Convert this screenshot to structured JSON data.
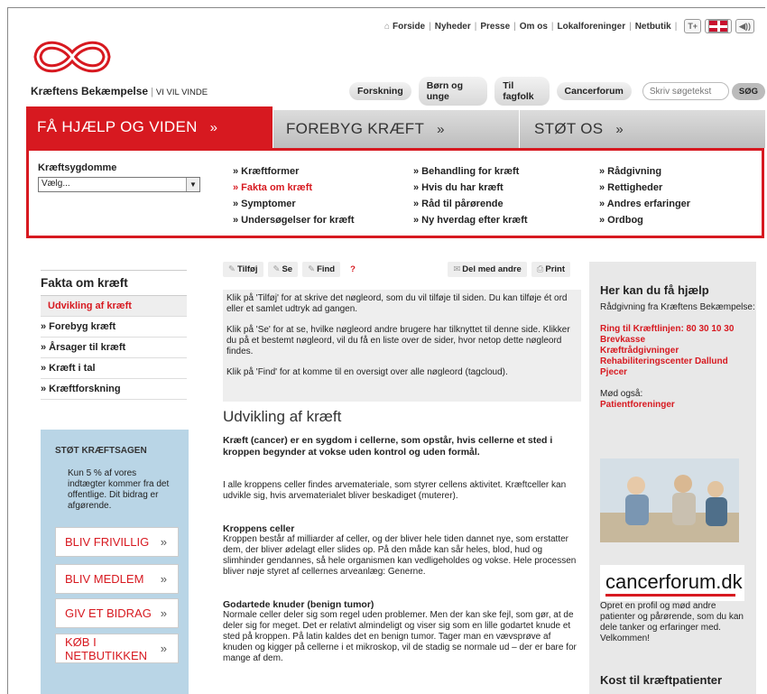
{
  "topnav": {
    "links": [
      "Forside",
      "Nyheder",
      "Presse",
      "Om os",
      "Lokalforeninger",
      "Netbutik"
    ],
    "text_size_button": "T+",
    "sound_button": "◀))"
  },
  "logo": {
    "name": "Kræftens Bekæmpelse",
    "slogan": "VI VIL VINDE"
  },
  "mainnav": [
    "Forskning",
    "Børn og unge",
    "Til fagfolk",
    "Cancerforum"
  ],
  "search": {
    "placeholder": "Skriv søgetekst",
    "button": "SØG"
  },
  "tabs": [
    {
      "label": "FÅ HJÆLP OG VIDEN",
      "arrow": "»"
    },
    {
      "label": "FOREBYG KRÆFT",
      "arrow": "»"
    },
    {
      "label": "STØT OS",
      "arrow": "»"
    }
  ],
  "mega": {
    "dropdown_label": "Kræftsygdomme",
    "dropdown_value": "Vælg...",
    "col1": [
      "» Kræftformer",
      "» Fakta om kræft",
      "» Symptomer",
      "» Undersøgelser for kræft"
    ],
    "col2": [
      "» Behandling for kræft",
      "» Hvis du har kræft",
      "» Råd til pårørende",
      "» Ny hverdag efter kræft"
    ],
    "col3": [
      "» Rådgivning",
      "» Rettigheder",
      "» Andres erfaringer",
      "» Ordbog"
    ]
  },
  "leftnav": {
    "heading": "Fakta om kræft",
    "active": "Udvikling af kræft",
    "items": [
      "» Forebyg kræft",
      "» Årsager til kræft",
      "» Kræft i tal",
      "» Kræftforskning"
    ]
  },
  "support": {
    "heading": "STØT KRÆFTSAGEN",
    "text": "Kun 5 % af vores indtægter kommer fra det offentlige. Dit bidrag er afgørende.",
    "buttons": [
      "BLIV FRIVILLIG",
      "BLIV MEDLEM",
      "GIV ET BIDRAG",
      "KØB I NETBUTIKKEN"
    ],
    "arrow": "»"
  },
  "tagbar": {
    "add": "Tilføj",
    "see": "Se",
    "find": "Find",
    "help": "?",
    "share": "Del med andre",
    "print": "Print"
  },
  "tagbox": {
    "p1": "Klik på 'Tilføj' for at skrive det nøgleord, som du vil tilføje til siden. Du kan tilføje ét ord eller et samlet udtryk ad gangen.",
    "p2": "Klik på 'Se' for at se, hvilke nøgleord andre brugere har tilknyttet til denne side. Klikker du på et bestemt nøgleord, vil du få en liste over de sider, hvor netop dette nøgleord findes.",
    "p3": "Klik på 'Find' for at komme til en oversigt over alle nøgleord (tagcloud)."
  },
  "article": {
    "title": "Udvikling af kræft",
    "lead": "Kræft (cancer) er en sygdom i cellerne, som opstår, hvis cellerne et sted i kroppen begynder at vokse uden kontrol og uden formål.",
    "p1": "I alle kroppens celler findes arvemateriale, som styrer cellens aktivitet. Kræftceller kan udvikle sig, hvis arvematerialet bliver beskadiget (muterer).",
    "h2": "Kroppens celler",
    "p2": "Kroppen består af milliarder af celler, og der bliver hele tiden dannet nye, som erstatter dem, der bliver ødelagt eller slides op. På den måde kan sår heles, blod, hud og slimhinder gendannes, så hele organismen kan vedligeholdes og vokse. Hele processen bliver nøje styret af cellernes arveanlæg: Generne.",
    "h3": "Godartede knuder (benign tumor)",
    "p3": "Normale celler deler sig som regel uden problemer. Men der kan ske fejl, som gør, at de deler sig for meget. Det er relativt almindeligt og viser sig som en lille godartet knude et sted på kroppen. På latin kaldes det en benign tumor. Tager man en vævsprøve af knuden og kigger på cellerne i et mikroskop, vil de stadig se normale ud – der er bare for mange af dem."
  },
  "rightside": {
    "heading": "Her kan du få hjælp",
    "intro": "Rådgivning fra Kræftens Bekæmpelse:",
    "links": [
      "Ring til Kræftlinjen: 80 30 10 30",
      "Brevkasse",
      "Kræftrådgivninger",
      "Rehabiliteringscenter Dallund",
      "Pjecer"
    ],
    "meet_label": "Mød også:",
    "meet_link": "Patientforeninger",
    "cancerforum_logo": "cancerforum.dk",
    "cancerforum_text": "Opret en profil og mød andre patienter og pårørende, som du kan dele tanker og erfaringer med. Velkommen!",
    "kost_heading": "Kost til kræftpatienter"
  }
}
